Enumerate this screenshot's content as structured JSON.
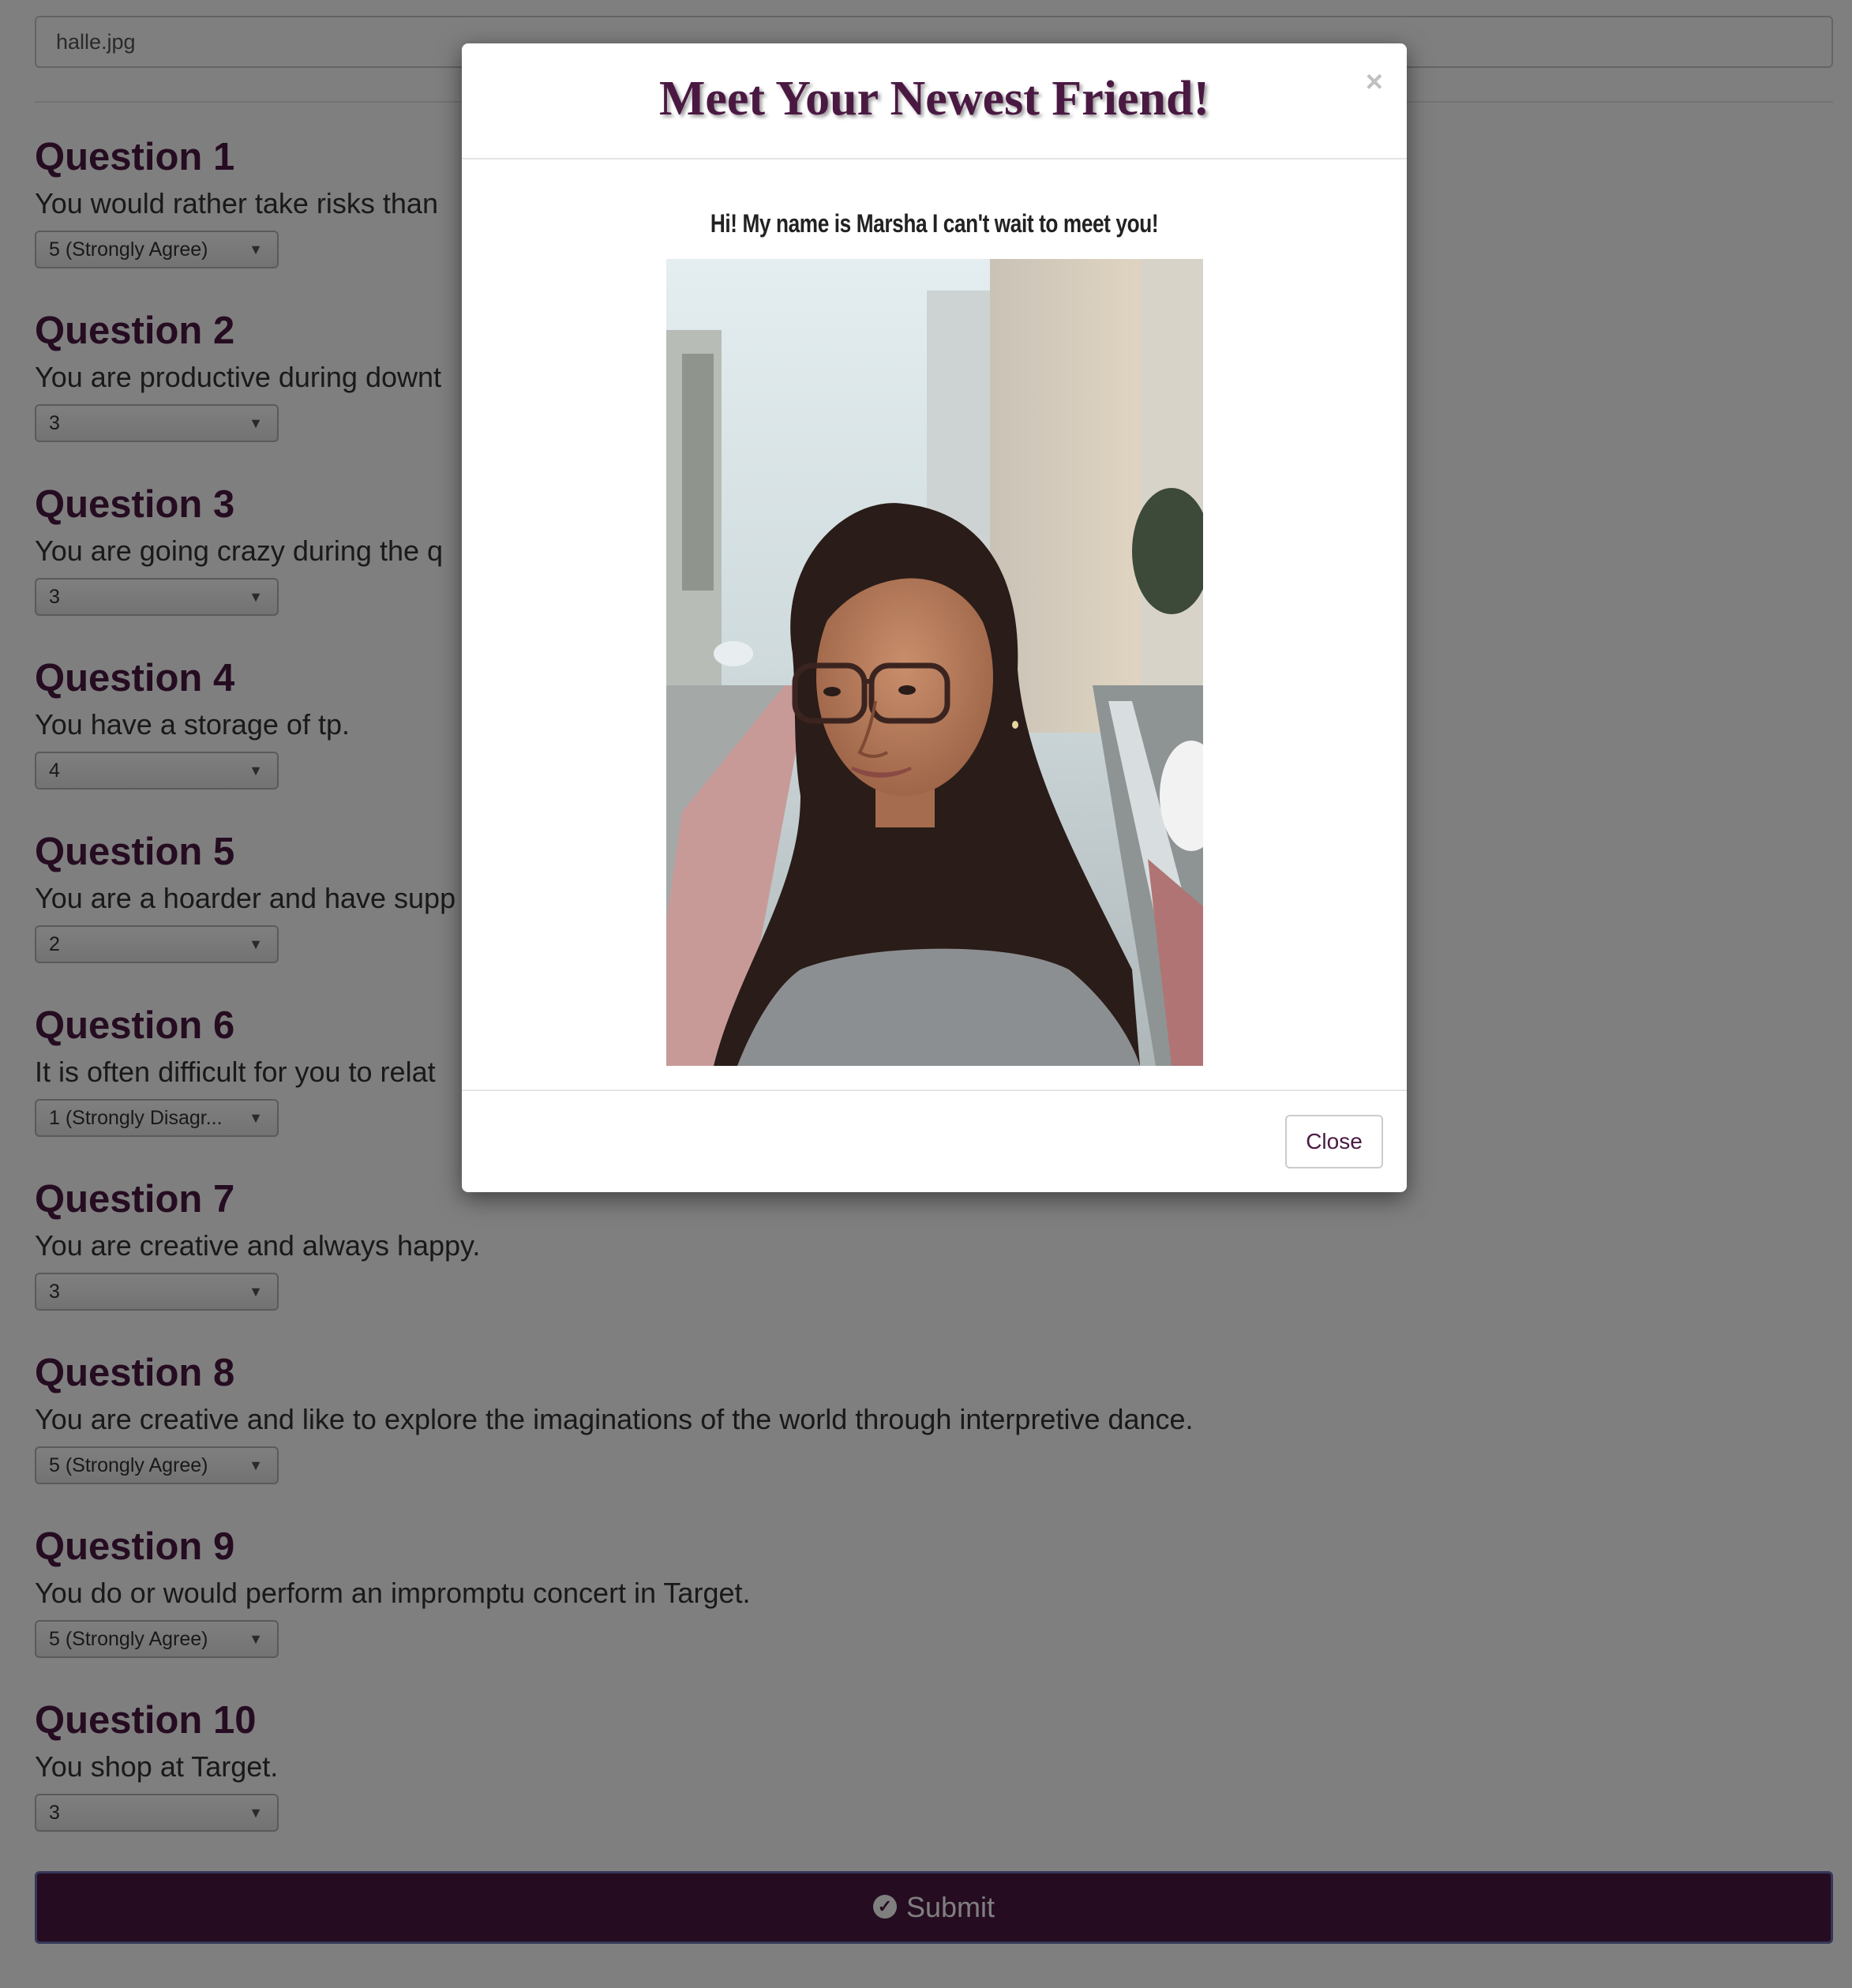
{
  "form": {
    "photo_value": "halle.jpg",
    "questions": [
      {
        "title": "Question 1",
        "text": "You would rather take risks than",
        "answer": "5 (Strongly Agree)"
      },
      {
        "title": "Question 2",
        "text": "You are productive during downt",
        "answer": "3"
      },
      {
        "title": "Question 3",
        "text": "You are going crazy during the q",
        "answer": "3"
      },
      {
        "title": "Question 4",
        "text": "You have a storage of tp.",
        "answer": "4"
      },
      {
        "title": "Question 5",
        "text": "You are a hoarder and have supp",
        "answer": "2"
      },
      {
        "title": "Question 6",
        "text": "It is often difficult for you to relat",
        "answer": "1 (Strongly Disagr..."
      },
      {
        "title": "Question 7",
        "text": "You are creative and always happy.",
        "answer": "3"
      },
      {
        "title": "Question 8",
        "text": "You are creative and like to explore the imaginations of the world through interpretive dance.",
        "answer": "5 (Strongly Agree)"
      },
      {
        "title": "Question 9",
        "text": "You do or would perform an impromptu concert in Target.",
        "answer": "5 (Strongly Agree)"
      },
      {
        "title": "Question 10",
        "text": "You shop at Target.",
        "answer": "3"
      }
    ],
    "submit_label": "Submit",
    "select_caret": "▼",
    "submit_icon_glyph": "✓"
  },
  "modal": {
    "title": "Meet Your Newest Friend!",
    "close_x": "×",
    "message": "Hi! My name is Marsha I can't wait to meet you!",
    "close_label": "Close"
  },
  "colors": {
    "accent": "#4a1942",
    "overlay": "rgba(0,0,0,0.5)"
  },
  "icons": {
    "submit": "check-circle-icon",
    "select": "chevron-down-icon",
    "modal_close": "close-icon"
  }
}
